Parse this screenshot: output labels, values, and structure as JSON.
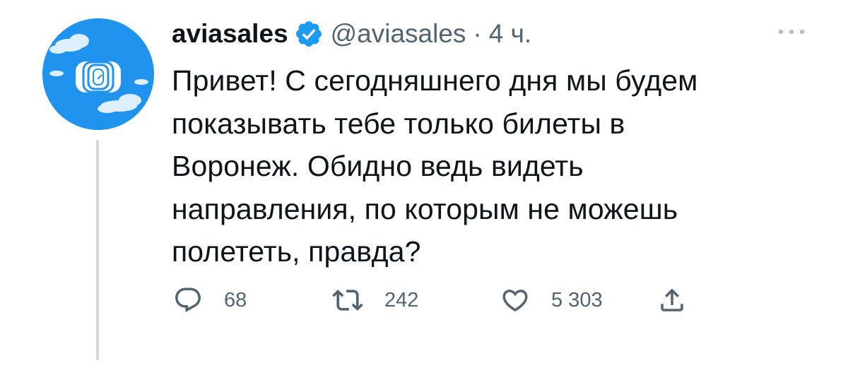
{
  "author": {
    "display_name": "aviasales",
    "handle": "@aviasales",
    "separator": "·",
    "time": "4 ч."
  },
  "tweet": {
    "text_lines": [
      "Привет! С сегодняшнего дня мы будем",
      "показывать тебе только билеты в",
      "Воронеж. Обидно ведь видеть",
      "направления, по которым не можешь",
      "полететь, правда?"
    ]
  },
  "actions": {
    "replies": "68",
    "retweets": "242",
    "likes": "5 303"
  },
  "icons": {
    "avatar": "aviasales-logo-icon",
    "verified": "verified-badge-icon",
    "more": "more-icon",
    "reply": "reply-icon",
    "retweet": "retweet-icon",
    "like": "heart-icon",
    "share": "share-icon"
  },
  "colors": {
    "avatar_bg": "#1f93ee",
    "verified": "#1d9bf0",
    "secondary_text": "#536471",
    "primary_text": "#0f1419",
    "thread_line": "#cfd9de"
  }
}
